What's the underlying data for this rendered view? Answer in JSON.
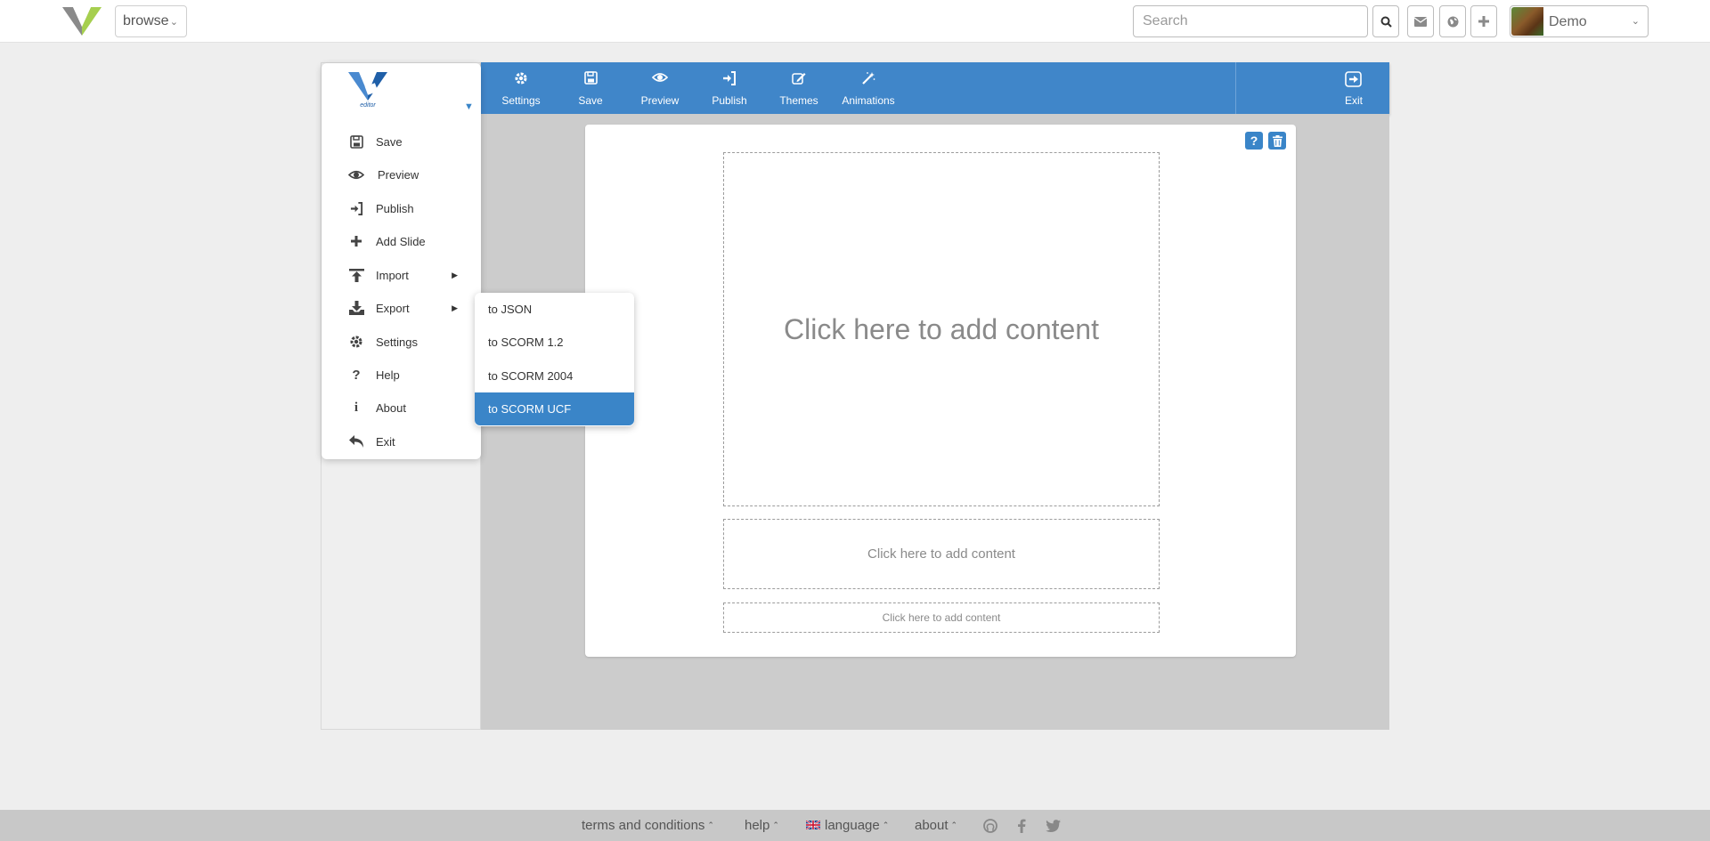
{
  "topbar": {
    "browse_label": "browse",
    "search_placeholder": "Search",
    "user_name": "Demo"
  },
  "toolbar": {
    "items": [
      {
        "label": "Settings",
        "icon": "gear-icon"
      },
      {
        "label": "Save",
        "icon": "floppy-icon"
      },
      {
        "label": "Preview",
        "icon": "eye-icon"
      },
      {
        "label": "Publish",
        "icon": "sign-in-icon"
      },
      {
        "label": "Themes",
        "icon": "edit-icon"
      },
      {
        "label": "Animations",
        "icon": "magic-wand-icon"
      }
    ],
    "exit_label": "Exit"
  },
  "menu": {
    "logo_text": "editor",
    "items": [
      {
        "label": "Save",
        "icon": "floppy-icon"
      },
      {
        "label": "Preview",
        "icon": "eye-icon"
      },
      {
        "label": "Publish",
        "icon": "sign-in-icon"
      },
      {
        "label": "Add Slide",
        "icon": "plus-icon"
      },
      {
        "label": "Import",
        "icon": "upload-icon"
      },
      {
        "label": "Export",
        "icon": "download-icon"
      },
      {
        "label": "Settings",
        "icon": "gear-icon"
      },
      {
        "label": "Help",
        "icon": "question-icon"
      },
      {
        "label": "About",
        "icon": "info-icon"
      },
      {
        "label": "Exit",
        "icon": "reply-icon"
      }
    ]
  },
  "export_submenu": {
    "items": [
      "to JSON",
      "to SCORM 1.2",
      "to SCORM 2004",
      "to SCORM UCF"
    ],
    "active_item": "to SCORM UCF"
  },
  "slide": {
    "help_icon": "?",
    "zones": [
      "Click here to add content",
      "Click here to add content",
      "Click here to add content"
    ]
  },
  "footer": {
    "terms": "terms and conditions",
    "help": "help",
    "language": "language",
    "about": "about"
  },
  "colors": {
    "accent": "#4086c9",
    "active_item": "#3a85c8",
    "footer_bg": "#c8c8c8",
    "canvas_bg": "#cccccc"
  }
}
